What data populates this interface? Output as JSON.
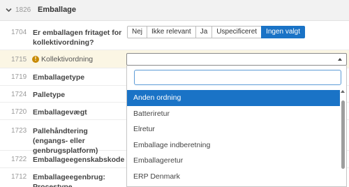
{
  "section": {
    "number": "1826",
    "title": "Emballage"
  },
  "rows": [
    {
      "number": "1704",
      "label": "Er emballagen fritaget for kollektivordning?"
    },
    {
      "number": "1715",
      "label": "Kollektivordning"
    },
    {
      "number": "1719",
      "label": "Emballagetype"
    },
    {
      "number": "1724",
      "label": "Palletype"
    },
    {
      "number": "1720",
      "label": "Emballagevægt"
    },
    {
      "number": "1723",
      "label": "Pallehåndtering (engangs- eller genbrugsplatform)"
    },
    {
      "number": "1722",
      "label": "Emballageegenskabskode"
    },
    {
      "number": "1712",
      "label": "Emballageegenbrug: Procestype"
    }
  ],
  "exempt_options": [
    "Nej",
    "Ikke relevant",
    "Ja",
    "Uspecificeret",
    "Ingen valgt"
  ],
  "exempt_selected": "Ingen valgt",
  "dropdown": {
    "search_value": "",
    "options": [
      "Anden ordning",
      "Batteriretur",
      "Elretur",
      "Emballage indberetning",
      "Emballageretur",
      "ERP Denmark"
    ],
    "highlighted": "Anden ordning"
  },
  "colors": {
    "accent": "#1a73c6",
    "warning": "#c88a00",
    "highlight_row": "#fbf6e4"
  }
}
